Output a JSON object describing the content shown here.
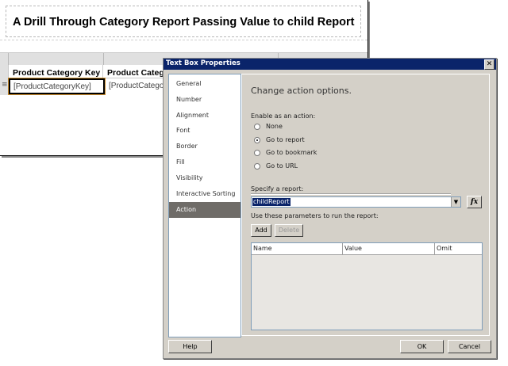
{
  "report": {
    "title": "A Drill Through Category Report Passing Value to child Report",
    "columns": [
      {
        "header": "Product Category Key",
        "value": "[ProductCategoryKey]"
      },
      {
        "header": "Product Catego",
        "value": "[ProductCategor"
      }
    ]
  },
  "dialog": {
    "title": "Text Box Properties",
    "close_glyph": "✕",
    "nav_items": [
      "General",
      "Number",
      "Alignment",
      "Font",
      "Border",
      "Fill",
      "Visibility",
      "Interactive Sorting",
      "Action"
    ],
    "active_nav": "Action",
    "heading": "Change action options.",
    "enable_label": "Enable as an action:",
    "actions": [
      {
        "label": "None",
        "selected": false
      },
      {
        "label": "Go to report",
        "selected": true
      },
      {
        "label": "Go to bookmark",
        "selected": false
      },
      {
        "label": "Go to URL",
        "selected": false
      }
    ],
    "specify_label": "Specify a report:",
    "report_value": "childReport",
    "combo_arrow": "▼",
    "fx_label": "fx",
    "params_label": "Use these parameters to run the report:",
    "add_label": "Add",
    "delete_label": "Delete",
    "grid_columns": [
      "Name",
      "Value",
      "Omit"
    ],
    "help_label": "Help",
    "ok_label": "OK",
    "cancel_label": "Cancel"
  }
}
